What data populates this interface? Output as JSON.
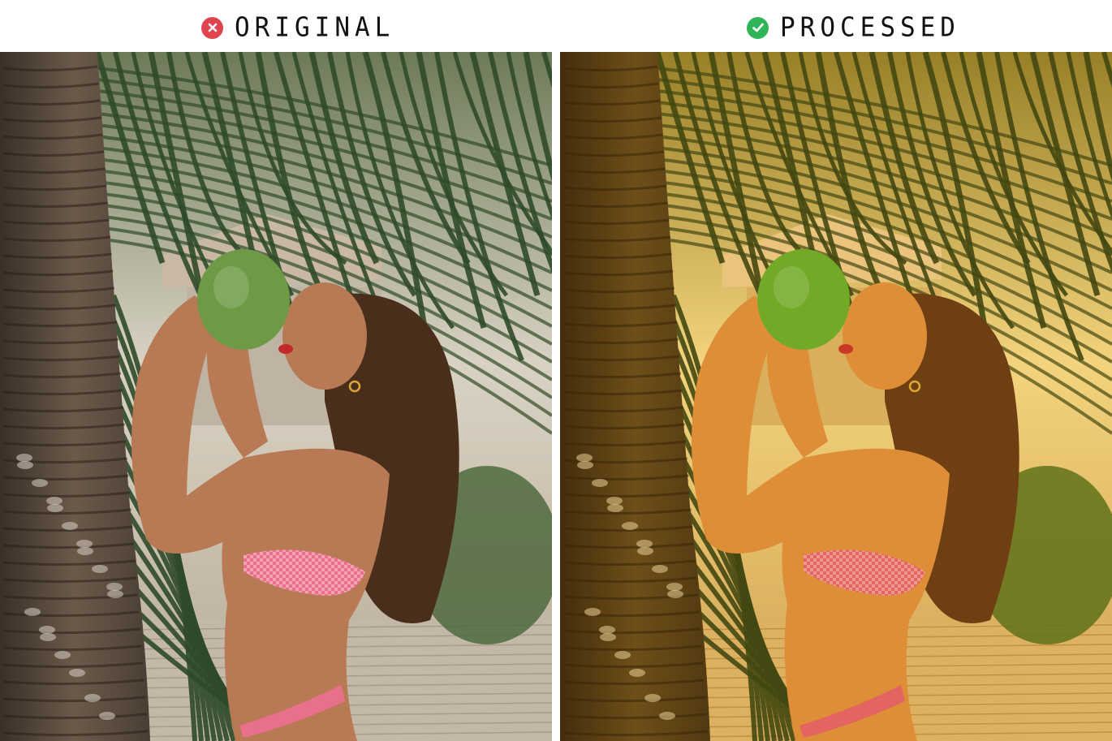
{
  "labels": {
    "original": {
      "text": "ORIGINAL",
      "icon": "x-circle-icon",
      "icon_color": "#e0444e"
    },
    "processed": {
      "text": "PROCESSED",
      "icon": "check-circle-icon",
      "icon_color": "#2fb457"
    }
  },
  "photos": {
    "original": {
      "subject": "woman drinking from green coconut beside palm trunk, tropical beach boardwalk",
      "palette": {
        "trunk": "#6b5a4a",
        "leaves": "#2f4a2a",
        "background": "#d9d2c3",
        "skin": "#b87a55",
        "hair": "#4a2e1c",
        "coconut": "#6e9a45",
        "bikini": "#e8708a"
      }
    },
    "processed": {
      "subject": "same photo with warm golden color grading",
      "palette": {
        "trunk": "#5a4218",
        "leaves": "#2a3a10",
        "background": "#f2d98a",
        "skin": "#d98a3a",
        "hair": "#5a3010",
        "coconut": "#5faa2a",
        "bikini": "#e05a6a"
      }
    }
  }
}
